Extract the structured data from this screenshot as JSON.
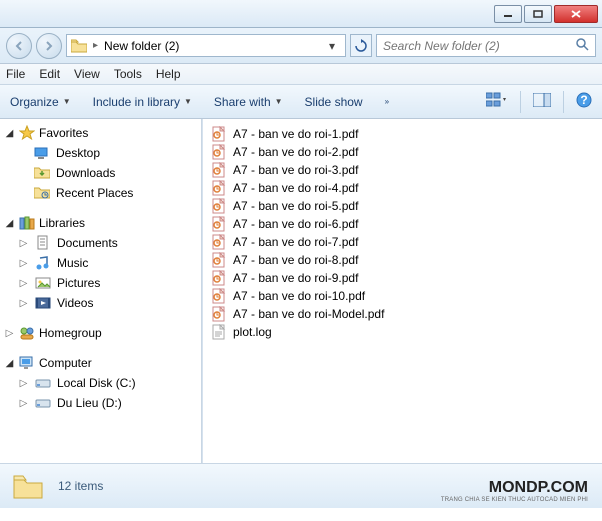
{
  "window": {
    "title": "New folder (2)"
  },
  "address": {
    "folder_name": "New folder (2)",
    "search_placeholder": "Search New folder (2)"
  },
  "menu": {
    "file": "File",
    "edit": "Edit",
    "view": "View",
    "tools": "Tools",
    "help": "Help"
  },
  "toolbar": {
    "organize": "Organize",
    "include": "Include in library",
    "share": "Share with",
    "slideshow": "Slide show"
  },
  "nav": {
    "favorites": {
      "label": "Favorites",
      "items": [
        {
          "label": "Desktop",
          "icon": "desktop"
        },
        {
          "label": "Downloads",
          "icon": "downloads"
        },
        {
          "label": "Recent Places",
          "icon": "recent"
        }
      ]
    },
    "libraries": {
      "label": "Libraries",
      "items": [
        {
          "label": "Documents",
          "icon": "documents"
        },
        {
          "label": "Music",
          "icon": "music"
        },
        {
          "label": "Pictures",
          "icon": "pictures"
        },
        {
          "label": "Videos",
          "icon": "videos"
        }
      ]
    },
    "homegroup": {
      "label": "Homegroup"
    },
    "computer": {
      "label": "Computer",
      "items": [
        {
          "label": "Local Disk (C:)",
          "icon": "disk"
        },
        {
          "label": "Du Lieu (D:)",
          "icon": "disk"
        }
      ]
    }
  },
  "files": [
    {
      "name": "A7 - ban ve do roi-1.pdf",
      "type": "pdf"
    },
    {
      "name": "A7 - ban ve do roi-2.pdf",
      "type": "pdf"
    },
    {
      "name": "A7 - ban ve do roi-3.pdf",
      "type": "pdf"
    },
    {
      "name": "A7 - ban ve do roi-4.pdf",
      "type": "pdf"
    },
    {
      "name": "A7 - ban ve do roi-5.pdf",
      "type": "pdf"
    },
    {
      "name": "A7 - ban ve do roi-6.pdf",
      "type": "pdf"
    },
    {
      "name": "A7 - ban ve do roi-7.pdf",
      "type": "pdf"
    },
    {
      "name": "A7 - ban ve do roi-8.pdf",
      "type": "pdf"
    },
    {
      "name": "A7 - ban ve do roi-9.pdf",
      "type": "pdf"
    },
    {
      "name": "A7 - ban ve do roi-10.pdf",
      "type": "pdf"
    },
    {
      "name": "A7 - ban ve do roi-Model.pdf",
      "type": "pdf"
    },
    {
      "name": "plot.log",
      "type": "log"
    }
  ],
  "status": {
    "count_text": "12 items"
  },
  "watermark": {
    "main": "MONDP.COM",
    "sub": "TRANG CHIA SE KIEN THUC AUTOCAD MIEN PHI"
  }
}
